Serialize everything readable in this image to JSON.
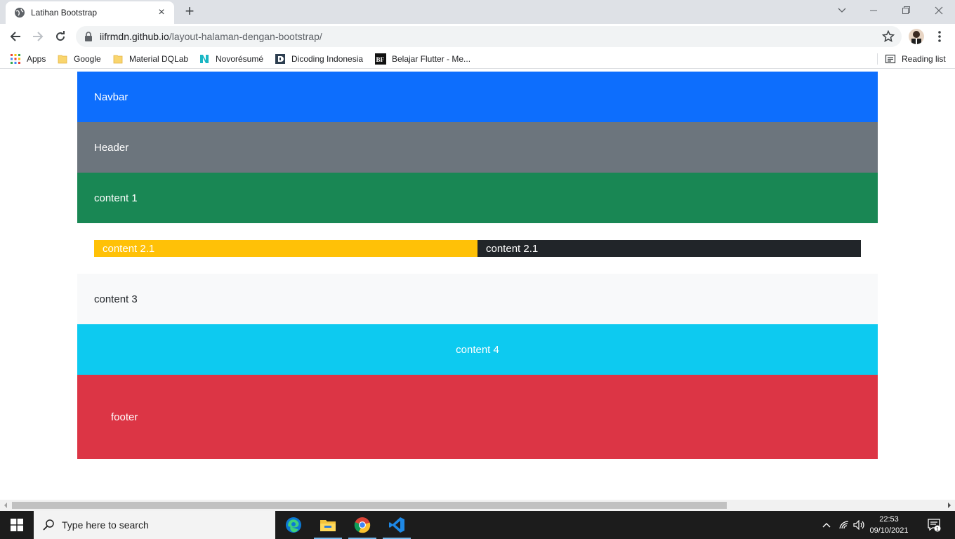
{
  "browser": {
    "tab_title": "Latihan Bootstrap",
    "url_host": "iifrmdn.github.io",
    "url_path": "/layout-halaman-dengan-bootstrap/",
    "bookmarks": [
      {
        "label": "Apps",
        "icon": "apps-grid-icon"
      },
      {
        "label": "Google",
        "icon": "folder-icon"
      },
      {
        "label": "Material DQLab",
        "icon": "folder-icon"
      },
      {
        "label": "Novorésumé",
        "icon": "novoresume-icon"
      },
      {
        "label": "Dicoding Indonesia",
        "icon": "dicoding-icon"
      },
      {
        "label": "Belajar Flutter - Me...",
        "icon": "bf-icon"
      }
    ],
    "reading_list": "Reading list"
  },
  "page": {
    "navbar": "Navbar",
    "header": "Header",
    "content1": "content 1",
    "content2_left": "content 2.1",
    "content2_right": "content 2.1",
    "content3": "content 3",
    "content4": "content 4",
    "footer": "footer"
  },
  "colors": {
    "navbar": "#0d6efd",
    "header": "#6c757d",
    "content1": "#198754",
    "content2_left": "#ffc107",
    "content2_right": "#212529",
    "content3": "#f8f9fa",
    "content4": "#0dcaf0",
    "footer": "#dc3545"
  },
  "taskbar": {
    "search_placeholder": "Type here to search",
    "time": "22:53",
    "date": "09/10/2021",
    "notification_count": "1"
  }
}
